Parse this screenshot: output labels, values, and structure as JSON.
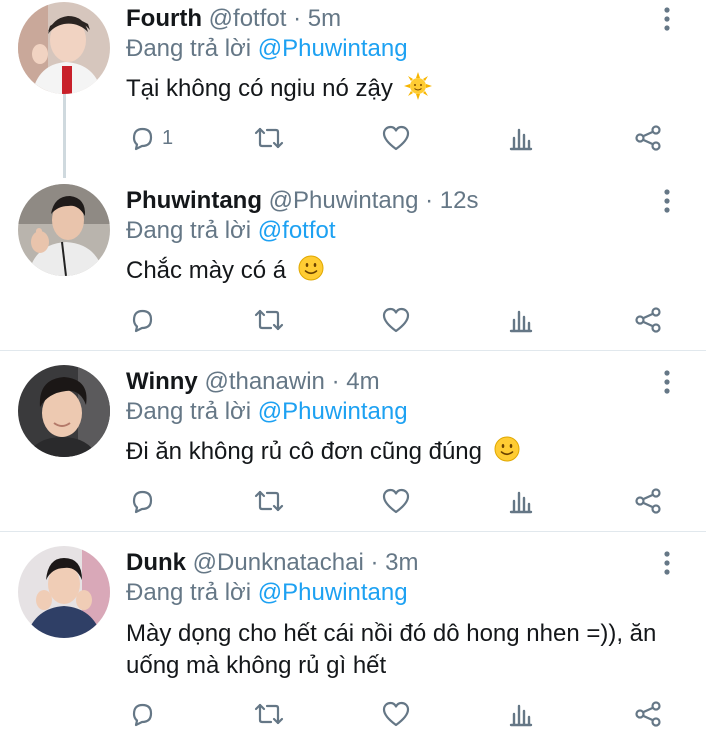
{
  "tweets": [
    {
      "name": "Fourth",
      "handle": "@fotfot",
      "separator": "·",
      "time": "5m",
      "reply_prefix": "Đang trả lời",
      "reply_to": "@Phuwintang",
      "text": "Tại không có ngiu nó zậy",
      "emoji": "sun-with-face",
      "reply_count": "1",
      "avatar": "avatar-fourth"
    },
    {
      "name": "Phuwintang",
      "handle": "@Phuwintang",
      "separator": "·",
      "time": "12s",
      "reply_prefix": "Đang trả lời",
      "reply_to": "@fotfot",
      "text": "Chắc mày có á",
      "emoji": "slightly-smiling-face",
      "reply_count": "",
      "avatar": "avatar-phuwintang"
    },
    {
      "name": "Winny",
      "handle": "@thanawin",
      "separator": "·",
      "time": "4m",
      "reply_prefix": "Đang trả lời",
      "reply_to": "@Phuwintang",
      "text": "Đi ăn không rủ cô đơn cũng đúng",
      "emoji": "slightly-smiling-face",
      "reply_count": "",
      "avatar": "avatar-winny"
    },
    {
      "name": "Dunk",
      "handle": "@Dunknatachai",
      "separator": "·",
      "time": "3m",
      "reply_prefix": "Đang trả lời",
      "reply_to": "@Phuwintang",
      "text": "Mày dọng cho hết cái nồi đó dô hong nhen =)), ăn uống mà không rủ gì hết",
      "emoji": "",
      "reply_count": "",
      "avatar": "avatar-dunk"
    }
  ],
  "icons": {
    "reply": "reply-icon",
    "retweet": "retweet-icon",
    "like": "heart-icon",
    "stats": "analytics-icon",
    "share": "share-icon",
    "menu": "more-vertical-icon"
  },
  "colors": {
    "name": "#14171a",
    "muted": "#657786",
    "mention": "#1da1f2",
    "divider": "#e1e8ed",
    "thread_line": "#cfd9de"
  }
}
